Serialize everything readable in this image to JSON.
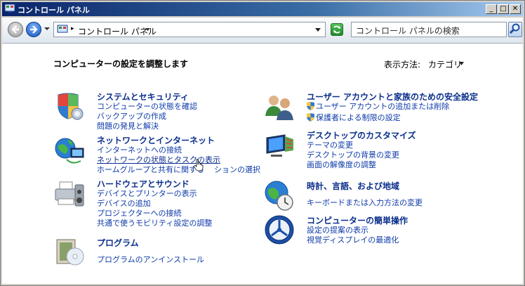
{
  "window": {
    "title": "コントロール パネル",
    "buttons": {
      "minimize": "_",
      "maximize": "□",
      "close": "✕"
    }
  },
  "address": {
    "crumb": "コントロール パネル",
    "search_placeholder": "コントロール パネルの検索"
  },
  "header": {
    "heading": "コンピューターの設定を調整します",
    "view_by_label": "表示方法:",
    "view_by_value": "カテゴリ"
  },
  "categories": {
    "system": {
      "title": "システムとセキュリティ",
      "links": [
        "コンピューターの状態を確認",
        "バックアップの作成",
        "問題の発見と解決"
      ]
    },
    "network": {
      "title": "ネットワークとインターネット",
      "links": [
        "インターネットへの接続",
        "ネットワークの状態とタスクの表示",
        "ホームグループと共有に関する",
        "ションの選択"
      ]
    },
    "hardware": {
      "title": "ハードウェアとサウンド",
      "links": [
        "デバイスとプリンターの表示",
        "デバイスの追加",
        "プロジェクターへの接続",
        "共通で使うモビリティ設定の調整"
      ]
    },
    "programs": {
      "title": "プログラム",
      "links": [
        "プログラムのアンインストール"
      ]
    },
    "users": {
      "title": "ユーザー アカウントと家族のための安全設定",
      "links": [
        "ユーザー アカウントの追加または削除",
        "保護者による制限の設定"
      ]
    },
    "appearance": {
      "title": "デスクトップのカスタマイズ",
      "links": [
        "テーマの変更",
        "デスクトップの背景の変更",
        "画面の解像度の調整"
      ]
    },
    "clock": {
      "title": "時計、言語、および地域",
      "links": [
        "キーボードまたは入力方法の変更"
      ]
    },
    "ease": {
      "title": "コンピューターの簡単操作",
      "links": [
        "設定の提案の表示",
        "視覚ディスプレイの最適化"
      ]
    }
  }
}
